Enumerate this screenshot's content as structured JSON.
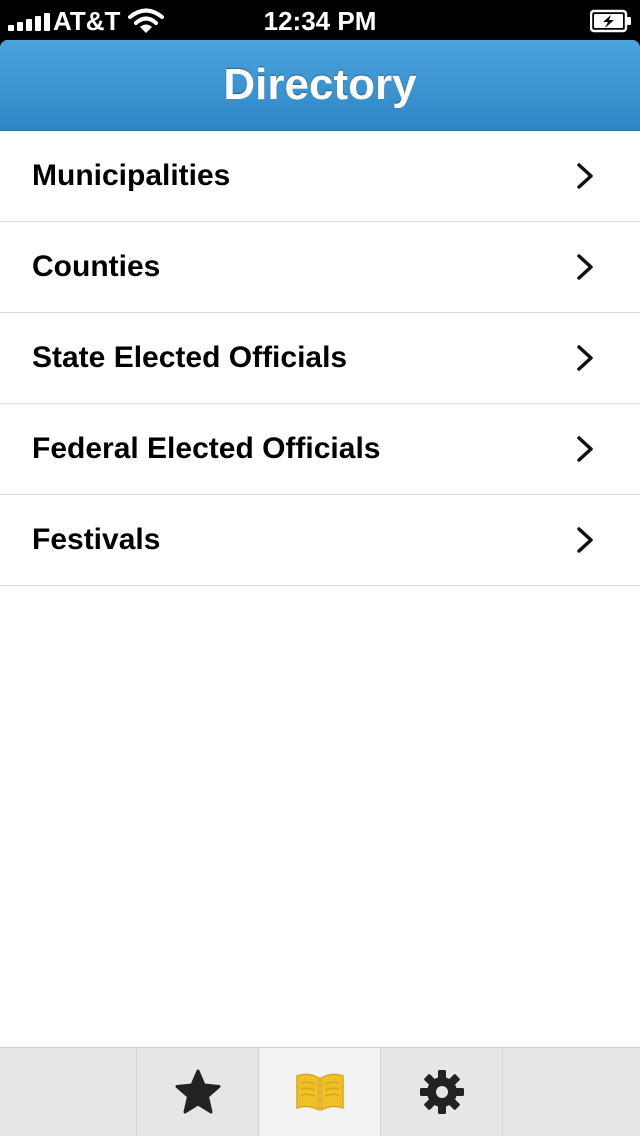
{
  "status_bar": {
    "carrier": "AT&T",
    "time": "12:34 PM"
  },
  "nav": {
    "title": "Directory"
  },
  "list": {
    "items": [
      {
        "label": "Municipalities"
      },
      {
        "label": "Counties"
      },
      {
        "label": "State Elected Officials"
      },
      {
        "label": "Federal Elected Officials"
      },
      {
        "label": "Festivals"
      }
    ]
  },
  "tab_bar": {
    "tabs": [
      {
        "icon": "star-icon",
        "selected": false
      },
      {
        "icon": "book-icon",
        "selected": true
      },
      {
        "icon": "gear-icon",
        "selected": false
      }
    ]
  },
  "colors": {
    "nav_top": "#4aa3dc",
    "nav_bottom": "#2f86c6",
    "active_tab_icon": "#f0c028",
    "inactive_tab_icon": "#222222"
  }
}
